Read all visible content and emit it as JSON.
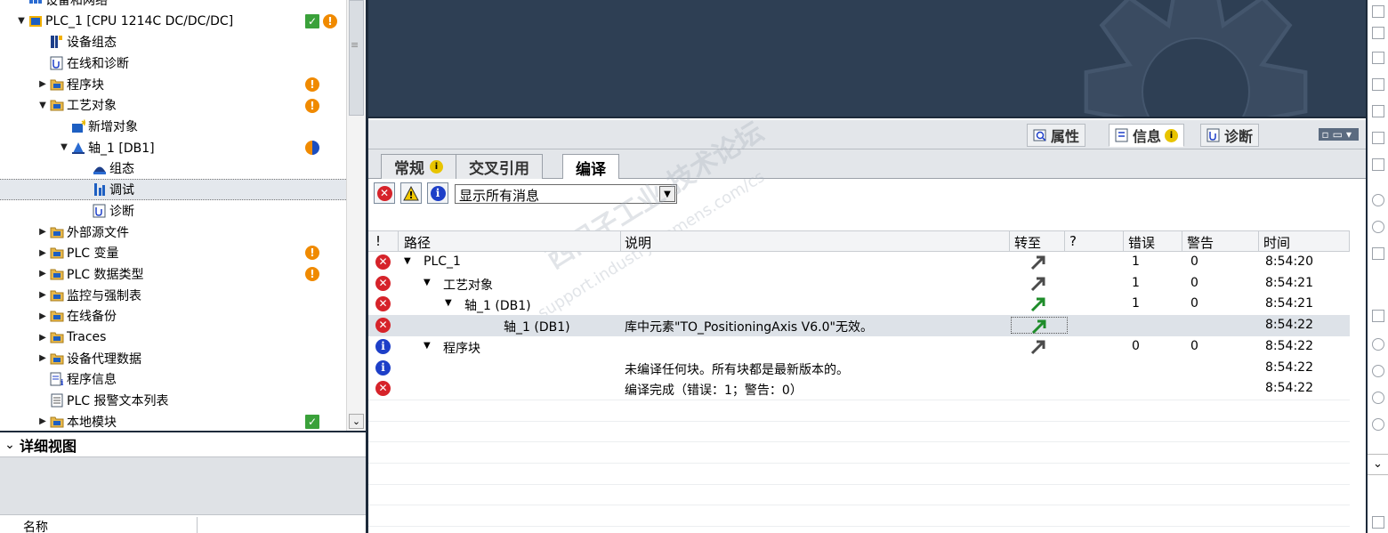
{
  "tree": {
    "items": [
      {
        "label": "设备和网络",
        "expander": "",
        "icon": "network-icon"
      },
      {
        "label": "PLC_1 [CPU 1214C DC/DC/DC]",
        "expander": "▼",
        "icon": "cpu-icon",
        "status": [
          "ok",
          "warning"
        ]
      },
      {
        "label": "设备组态",
        "expander": "",
        "icon": "device-config-icon"
      },
      {
        "label": "在线和诊断",
        "expander": "",
        "icon": "online-diagnostics-icon"
      },
      {
        "label": "程序块",
        "expander": "▶",
        "icon": "folder-program-blocks-icon",
        "status": [
          "warning"
        ]
      },
      {
        "label": "工艺对象",
        "expander": "▼",
        "icon": "folder-technology-objects-icon",
        "status": [
          "warning"
        ]
      },
      {
        "label": "新增对象",
        "expander": "",
        "icon": "add-object-icon"
      },
      {
        "label": "轴_1 [DB1]",
        "expander": "▼",
        "icon": "axis-icon",
        "status": [
          "partial"
        ]
      },
      {
        "label": "组态",
        "expander": "",
        "icon": "configuration-icon"
      },
      {
        "label": "调试",
        "expander": "",
        "icon": "commissioning-icon",
        "selected": true
      },
      {
        "label": "诊断",
        "expander": "",
        "icon": "diagnostics-icon"
      },
      {
        "label": "外部源文件",
        "expander": "▶",
        "icon": "folder-external-sources-icon"
      },
      {
        "label": "PLC 变量",
        "expander": "▶",
        "icon": "folder-plc-tags-icon",
        "status": [
          "warning"
        ]
      },
      {
        "label": "PLC 数据类型",
        "expander": "▶",
        "icon": "folder-plc-datatypes-icon",
        "status": [
          "warning"
        ]
      },
      {
        "label": "监控与强制表",
        "expander": "▶",
        "icon": "folder-watch-tables-icon"
      },
      {
        "label": "在线备份",
        "expander": "▶",
        "icon": "folder-online-backups-icon"
      },
      {
        "label": "Traces",
        "expander": "▶",
        "icon": "folder-traces-icon"
      },
      {
        "label": "设备代理数据",
        "expander": "▶",
        "icon": "folder-device-proxy-icon"
      },
      {
        "label": "程序信息",
        "expander": "",
        "icon": "program-info-icon"
      },
      {
        "label": "PLC 报警文本列表",
        "expander": "",
        "icon": "alarm-text-list-icon"
      },
      {
        "label": "本地模块",
        "expander": "▶",
        "icon": "folder-local-modules-icon",
        "status": [
          "ok"
        ]
      }
    ]
  },
  "detail": {
    "title": "详细视图",
    "column_name": "名称"
  },
  "inspector": {
    "tabs": [
      {
        "label": "属性",
        "icon": "properties-icon"
      },
      {
        "label": "信息",
        "icon": "info-tab-icon"
      },
      {
        "label": "诊断",
        "icon": "diagnostics-tab-icon"
      }
    ],
    "subtabs": [
      {
        "label": "常规"
      },
      {
        "label": "交叉引用"
      },
      {
        "label": "编译"
      }
    ],
    "filter": {
      "selected": "显示所有消息"
    },
    "columns": {
      "bang": "!",
      "path": "路径",
      "desc": "说明",
      "goto": "转至",
      "q": "?",
      "errors": "错误",
      "warnings": "警告",
      "time": "时间"
    },
    "messages": [
      {
        "type": "error",
        "expander": "▼",
        "path": "PLC_1",
        "desc": "",
        "goto": true,
        "errors": "1",
        "warnings": "0",
        "time": "8:54:20"
      },
      {
        "type": "error",
        "expander": "▼",
        "path": "工艺对象",
        "desc": "",
        "goto": true,
        "errors": "1",
        "warnings": "0",
        "time": "8:54:21"
      },
      {
        "type": "error",
        "expander": "▼",
        "path": "轴_1 (DB1)",
        "desc": "",
        "goto": true,
        "errors": "1",
        "warnings": "0",
        "time": "8:54:21"
      },
      {
        "type": "error",
        "expander": "",
        "path": "轴_1 (DB1)",
        "desc": "库中元素\"TO_PositioningAxis V6.0\"无效。",
        "goto": true,
        "errors": "",
        "warnings": "",
        "time": "8:54:22"
      },
      {
        "type": "info",
        "expander": "▼",
        "path": "程序块",
        "desc": "",
        "goto": true,
        "errors": "0",
        "warnings": "0",
        "time": "8:54:22"
      },
      {
        "type": "info",
        "expander": "",
        "path": "",
        "desc": "未编译任何块。所有块都是最新版本的。",
        "goto": false,
        "errors": "",
        "warnings": "",
        "time": "8:54:22"
      },
      {
        "type": "error",
        "expander": "",
        "path": "",
        "desc": "编译完成（错误：1；警告：0）",
        "goto": false,
        "errors": "",
        "warnings": "",
        "time": "8:54:22"
      }
    ]
  },
  "watermark": {
    "line1": "西门子工业  技术论坛",
    "line2": "support.industry.siemens.com/cs"
  },
  "colors": {
    "error": "#d6232a",
    "info": "#1d3fc8",
    "warning": "#f08a00",
    "ok": "#3aa13a",
    "dark_frame": "#1d2a3a",
    "top_area": "#2e3f54"
  }
}
